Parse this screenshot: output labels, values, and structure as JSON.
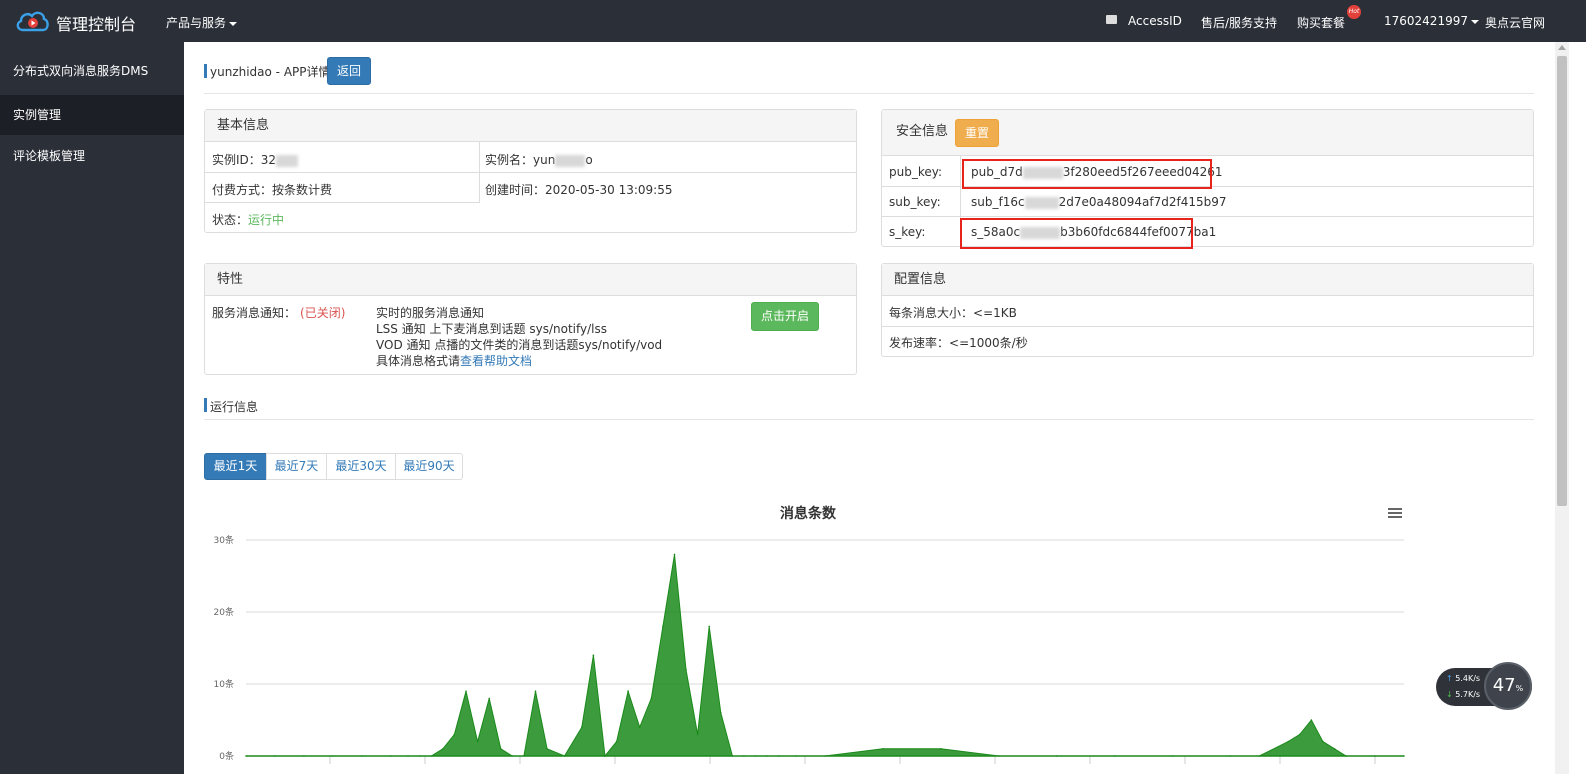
{
  "topbar": {
    "brand": "管理控制台",
    "products_menu": "产品与服务",
    "access_id": "AccessID",
    "support": "售后/服务支持",
    "buy": "购买套餐",
    "hot_badge": "Hot",
    "user": "17602421997",
    "website": "奥点云官网"
  },
  "sidebar": {
    "title": "分布式双向消息服务DMS",
    "items": [
      {
        "label": "实例管理",
        "active": true
      },
      {
        "label": "评论模板管理",
        "active": false
      }
    ]
  },
  "page": {
    "title": "yunzhidao - APP详情",
    "back_button": "返回"
  },
  "basic_info": {
    "header": "基本信息",
    "instance_id_label": "实例ID：",
    "instance_id_value": "32",
    "instance_name_label": "实例名：",
    "instance_name_value_prefix": "yun",
    "instance_name_value_suffix": "o",
    "billing_label": "付费方式：",
    "billing_value": "按条数计费",
    "created_label": "创建时间：",
    "created_value": "2020-05-30 13:09:55",
    "status_label": "状态：",
    "status_value": "运行中"
  },
  "security_info": {
    "header": "安全信息",
    "reset_button": "重置",
    "pub_key_label": "pub_key:",
    "pub_key_prefix": "pub_d7d",
    "pub_key_suffix": "3f280eed5f267eeed04261",
    "sub_key_label": "sub_key:",
    "sub_key_prefix": "sub_f16c",
    "sub_key_suffix": "2d7e0a48094af7d2f415b97",
    "s_key_label": "s_key:",
    "s_key_prefix": "s_58a0c",
    "s_key_suffix": "b3b60fdc6844fef0077ba1"
  },
  "features": {
    "header": "特性",
    "service_notify_label": "服务消息通知：",
    "service_notify_status": "(已关闭)",
    "desc_line1": "实时的服务消息通知",
    "desc_line2": "LSS 通知 上下麦消息到话题 sys/notify/lss",
    "desc_line3": "VOD 通知 点播的文件类的消息到话题sys/notify/vod",
    "desc_line4_prefix": "具体消息格式请",
    "desc_line4_link": "查看帮助文档",
    "open_button": "点击开启"
  },
  "config_info": {
    "header": "配置信息",
    "msg_size_label": "每条消息大小：",
    "msg_size_value": "<=1KB",
    "rate_label": "发布速率：",
    "rate_value": "<=1000条/秒"
  },
  "run_info": {
    "title": "运行信息",
    "range_buttons": [
      {
        "label": "最近1天",
        "active": true
      },
      {
        "label": "最近7天",
        "active": false
      },
      {
        "label": "最近30天",
        "active": false
      },
      {
        "label": "最近90天",
        "active": false
      }
    ]
  },
  "speed_widget": {
    "up": "5.4",
    "down": "5.7",
    "unit": "K/s",
    "percent": "47",
    "percent_sign": "%"
  },
  "chart_data": {
    "type": "area",
    "title": "消息条数",
    "y_tick_labels": [
      "30条",
      "20条",
      "10条",
      "0条"
    ],
    "ylim": [
      0,
      30
    ],
    "grid": true,
    "series_color": "#1a8a1a",
    "x": [
      0,
      5,
      10,
      15,
      20,
      25,
      28,
      30,
      32,
      34,
      36,
      38,
      40,
      42,
      44,
      46,
      48,
      50,
      52,
      55,
      58,
      60,
      62,
      64,
      66,
      68,
      70,
      72,
      74,
      76,
      78,
      80,
      82,
      84,
      86,
      88,
      90,
      92,
      95,
      100,
      110,
      120,
      130,
      140,
      150,
      160,
      170,
      175,
      180,
      182,
      184,
      186,
      188,
      190,
      195,
      200
    ],
    "values": [
      0,
      0,
      0,
      0,
      0,
      0,
      0,
      0,
      0,
      1,
      3,
      9,
      2,
      8,
      1,
      0,
      0,
      9,
      1,
      0,
      4,
      14,
      0,
      2,
      9,
      4,
      8,
      18,
      28,
      12,
      3,
      18,
      6,
      0,
      0,
      0,
      0,
      0,
      0,
      0,
      1,
      1,
      0,
      0,
      0,
      0,
      0,
      0,
      2,
      3,
      5,
      2,
      1,
      0,
      0,
      0
    ]
  }
}
